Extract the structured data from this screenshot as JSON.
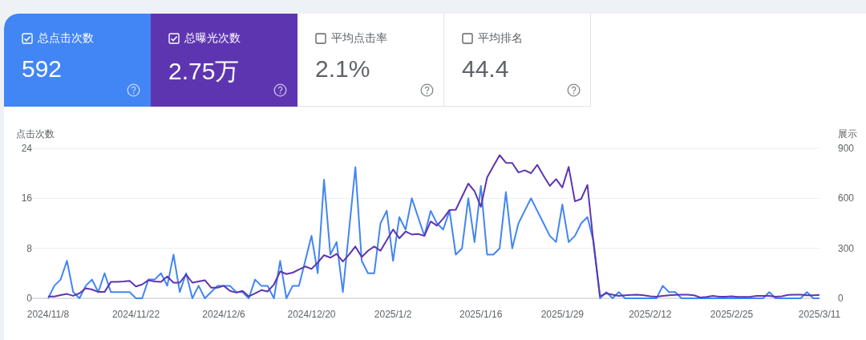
{
  "metrics": [
    {
      "label": "总点击次数",
      "value": "592",
      "checked": true,
      "color": "#4285f4"
    },
    {
      "label": "总曝光次数",
      "value": "2.75万",
      "checked": true,
      "color": "#5e35b1"
    },
    {
      "label": "平均点击率",
      "value": "2.1%",
      "checked": false
    },
    {
      "label": "平均排名",
      "value": "44.4",
      "checked": false
    }
  ],
  "chart": {
    "chart_data": {
      "type": "line",
      "categories": [
        "2024/11/8",
        null,
        null,
        null,
        null,
        null,
        null,
        null,
        null,
        null,
        null,
        null,
        null,
        null,
        "2024/11/22",
        null,
        null,
        null,
        null,
        null,
        null,
        null,
        null,
        null,
        null,
        null,
        null,
        null,
        "2024/12/6",
        null,
        null,
        null,
        null,
        null,
        null,
        null,
        null,
        null,
        null,
        null,
        null,
        null,
        "2024/12/20",
        null,
        null,
        null,
        null,
        null,
        null,
        null,
        null,
        null,
        null,
        null,
        null,
        "2025/1/2",
        null,
        null,
        null,
        null,
        null,
        null,
        null,
        null,
        null,
        null,
        null,
        null,
        null,
        "2025/1/16",
        null,
        null,
        null,
        null,
        null,
        null,
        null,
        null,
        null,
        null,
        null,
        null,
        "2025/1/29",
        null,
        null,
        null,
        null,
        null,
        null,
        null,
        null,
        null,
        null,
        null,
        null,
        null,
        "2025/2/12",
        null,
        null,
        null,
        null,
        null,
        null,
        null,
        null,
        null,
        null,
        null,
        null,
        "2025/2/25",
        null,
        null,
        null,
        null,
        null,
        null,
        null,
        null,
        null,
        null,
        null,
        null,
        null,
        "2025/3/11"
      ],
      "ylabel": "点击次数",
      "y2label": "展示",
      "ylim": [
        0,
        24
      ],
      "y2lim": [
        0,
        900
      ],
      "yticks": [
        0,
        8,
        16,
        24
      ],
      "y2ticks": [
        0,
        300,
        600,
        900
      ],
      "series": [
        {
          "color": "#4285f4",
          "values": [
            0,
            2,
            3,
            6,
            1,
            0,
            2,
            3,
            1,
            4,
            1,
            1,
            1,
            1,
            0,
            0,
            3,
            3,
            4,
            2,
            7,
            1,
            4,
            0,
            2,
            0,
            1,
            2,
            2,
            2,
            1,
            1,
            0,
            3,
            2,
            2,
            0,
            6,
            0,
            2,
            2,
            6,
            10,
            4,
            19,
            7,
            9,
            1,
            11,
            21,
            6,
            4,
            4,
            12,
            14,
            6,
            13,
            11,
            16,
            13,
            10,
            14,
            12,
            11,
            14,
            7,
            8,
            16,
            9,
            18,
            7,
            7,
            8,
            17,
            8,
            12,
            14,
            16,
            14,
            12,
            10,
            9,
            15,
            9,
            10,
            12,
            13,
            9,
            0,
            1,
            0,
            1,
            0,
            0,
            0,
            0,
            0,
            0,
            2,
            1,
            1,
            0,
            0,
            0,
            0,
            0,
            0,
            0,
            0,
            0,
            0,
            0,
            0,
            0,
            0,
            1,
            0,
            0,
            0,
            0,
            0,
            1,
            0,
            0
          ]
        },
        {
          "color": "#5e35b1",
          "axis": "y2",
          "values": [
            11,
            11,
            19,
            26,
            15,
            30,
            60,
            53,
            38,
            38,
            98,
            98,
            101,
            105,
            71,
            83,
            109,
            101,
            98,
            131,
            94,
            94,
            143,
            94,
            101,
            109,
            64,
            64,
            75,
            45,
            34,
            45,
            11,
            30,
            49,
            41,
            83,
            161,
            146,
            154,
            173,
            191,
            176,
            214,
            259,
            244,
            266,
            221,
            263,
            311,
            248,
            285,
            311,
            285,
            349,
            413,
            360,
            401,
            383,
            386,
            375,
            461,
            436,
            478,
            530,
            532,
            610,
            688,
            643,
            549,
            726,
            793,
            859,
            814,
            812,
            755,
            768,
            751,
            801,
            735,
            675,
            715,
            665,
            789,
            582,
            597,
            680,
            320,
            13,
            30,
            22,
            15,
            18,
            20,
            22,
            18,
            12,
            10,
            15,
            18,
            20,
            22,
            22,
            18,
            5,
            8,
            15,
            10,
            10,
            12,
            8,
            8,
            10,
            14,
            15,
            15,
            10,
            12,
            20,
            22,
            22,
            18,
            18,
            20
          ]
        }
      ]
    }
  }
}
